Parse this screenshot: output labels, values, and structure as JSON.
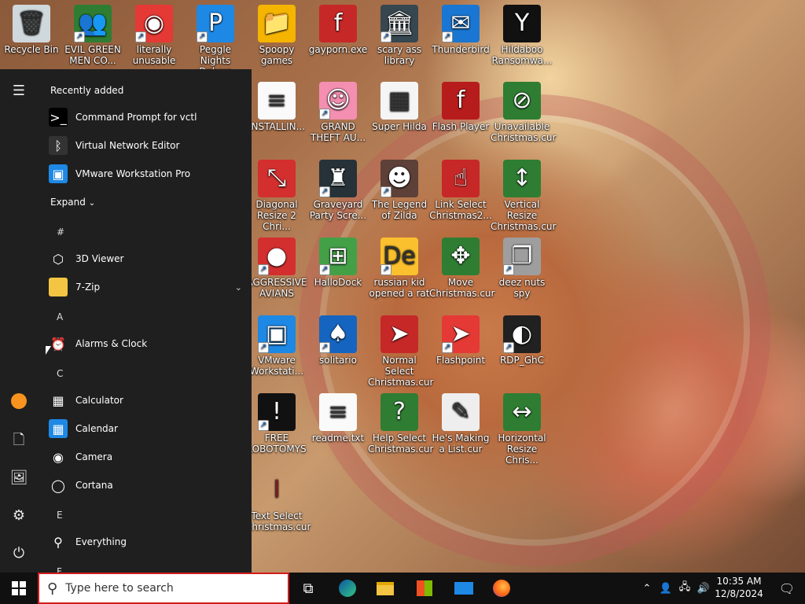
{
  "desktop": {
    "icons": [
      {
        "label": "Recycle Bin",
        "icon": "recycle-bin-icon",
        "glyph": "🗑",
        "bg": "#cfd8dc",
        "shortcut": false
      },
      {
        "label": "EVIL GREEN MEN CO...",
        "icon": "green-men-icon",
        "glyph": "👥",
        "bg": "#2e7d32",
        "shortcut": true
      },
      {
        "label": "literally unusable",
        "icon": "chrome-icon",
        "glyph": "◉",
        "bg": "#e53935",
        "shortcut": true
      },
      {
        "label": "Peggle Nights Deluxe",
        "icon": "peggle-icon",
        "glyph": "P",
        "bg": "#1e88e5",
        "shortcut": true
      },
      {
        "label": "Spoopy games",
        "icon": "folder-icon",
        "glyph": "📁",
        "bg": "#f4b400",
        "shortcut": false
      },
      {
        "label": "gayporn.exe",
        "icon": "flash-icon",
        "glyph": "f",
        "bg": "#c62828",
        "shortcut": false
      },
      {
        "label": "scary ass library",
        "icon": "library-icon",
        "glyph": "🏛",
        "bg": "#37474f",
        "shortcut": true
      },
      {
        "label": "Thunderbird",
        "icon": "thunderbird-icon",
        "glyph": "✉",
        "bg": "#1976d2",
        "shortcut": true
      },
      {
        "label": "Hildaboo Ransomwa...",
        "icon": "yashma-icon",
        "glyph": "Y",
        "bg": "#111111",
        "shortcut": false
      },
      {
        "label": "INSTALLIN...",
        "icon": "text-file-icon",
        "glyph": "≡",
        "bg": "#fafafa",
        "shortcut": false
      },
      {
        "label": "GRAND THEFT AU...",
        "icon": "anime-girl-icon",
        "glyph": "☺",
        "bg": "#f48fb1",
        "shortcut": true
      },
      {
        "label": "Super Hilda",
        "icon": "pixel-cat-icon",
        "glyph": "▦",
        "bg": "#f5f5f5",
        "shortcut": false
      },
      {
        "label": "Flash Player",
        "icon": "flash-player-icon",
        "glyph": "f",
        "bg": "#b71c1c",
        "shortcut": false
      },
      {
        "label": "Unavailable Christmas.cur",
        "icon": "unavailable-cursor-icon",
        "glyph": "⊘",
        "bg": "#2e7d32",
        "shortcut": false
      },
      {
        "label": "Diagonal Resize 2 Chri...",
        "icon": "diagonal-resize-icon",
        "glyph": "⤡",
        "bg": "#d32f2f",
        "shortcut": false
      },
      {
        "label": "Graveyard Party Scre...",
        "icon": "graveyard-icon",
        "glyph": "♜",
        "bg": "#263238",
        "shortcut": true
      },
      {
        "label": "The Legend of Zilda",
        "icon": "zilda-icon",
        "glyph": "☻",
        "bg": "#5d4037",
        "shortcut": true
      },
      {
        "label": "Link Select Christmas2...",
        "icon": "link-select-icon",
        "glyph": "☝",
        "bg": "#c62828",
        "shortcut": false
      },
      {
        "label": "Vertical Resize Christmas.cur",
        "icon": "vertical-resize-icon",
        "glyph": "↕",
        "bg": "#2e7d32",
        "shortcut": false
      },
      {
        "label": "AGGRESSIVE AVIANS",
        "icon": "angry-bird-icon",
        "glyph": "●",
        "bg": "#d32f2f",
        "shortcut": true
      },
      {
        "label": "HalloDock",
        "icon": "windows-flag-icon",
        "glyph": "⊞",
        "bg": "#43a047",
        "shortcut": true
      },
      {
        "label": "russian kid opened a rat",
        "icon": "de-icon",
        "glyph": "De",
        "bg": "#fbc02d",
        "shortcut": true
      },
      {
        "label": "Move Christmas.cur",
        "icon": "move-cursor-icon",
        "glyph": "✥",
        "bg": "#2e7d32",
        "shortcut": false
      },
      {
        "label": "deez nuts spy",
        "icon": "windows-stack-icon",
        "glyph": "❐",
        "bg": "#9e9e9e",
        "shortcut": true
      },
      {
        "label": "VMware Workstati...",
        "icon": "vmware-icon",
        "glyph": "▣",
        "bg": "#1e88e5",
        "shortcut": true
      },
      {
        "label": "solitario",
        "icon": "solitaire-icon",
        "glyph": "♠",
        "bg": "#1565c0",
        "shortcut": true
      },
      {
        "label": "Normal Select Christmas.cur",
        "icon": "normal-select-icon",
        "glyph": "➤",
        "bg": "#c62828",
        "shortcut": false
      },
      {
        "label": "Flashpoint",
        "icon": "flashpoint-icon",
        "glyph": "➤",
        "bg": "#e53935",
        "shortcut": true
      },
      {
        "label": "RDP_GhC",
        "icon": "rdp-icon",
        "glyph": "◐",
        "bg": "#212121",
        "shortcut": true
      },
      {
        "label": "FREE LOBOTOMYS",
        "icon": "lobotomy-icon",
        "glyph": "!",
        "bg": "#111111",
        "shortcut": true
      },
      {
        "label": "readme.txt",
        "icon": "text-file-icon",
        "glyph": "≡",
        "bg": "#fafafa",
        "shortcut": false
      },
      {
        "label": "Help Select Christmas.cur",
        "icon": "help-select-icon",
        "glyph": "?",
        "bg": "#2e7d32",
        "shortcut": false
      },
      {
        "label": "He's Making a List.cur",
        "icon": "scroll-list-icon",
        "glyph": "✎",
        "bg": "#eeeeee",
        "shortcut": false
      },
      {
        "label": "Horizontal Resize Chris...",
        "icon": "horizontal-resize-icon",
        "glyph": "↔",
        "bg": "#2e7d32",
        "shortcut": false
      },
      {
        "label": "Text Select Christmas.cur",
        "icon": "text-select-icon",
        "glyph": "I",
        "bg": "transparent",
        "shortcut": false
      }
    ]
  },
  "start_menu": {
    "recently_added": "Recently added",
    "expand": "Expand",
    "recent": [
      {
        "label": "Command Prompt for vctl",
        "icon": "command-prompt-icon",
        "glyph": ">_",
        "bg": "#000000"
      },
      {
        "label": "Virtual Network Editor",
        "icon": "network-editor-icon",
        "glyph": "ᛒ",
        "bg": "#333333"
      },
      {
        "label": "VMware Workstation Pro",
        "icon": "vmware-icon",
        "glyph": "▣",
        "bg": "#1e88e5"
      }
    ],
    "letters": [
      "#",
      "A",
      "C",
      "E",
      "F"
    ],
    "apps_hash": [
      {
        "label": "3D Viewer",
        "icon": "cube-icon",
        "glyph": "⬡",
        "bg": "transparent"
      },
      {
        "label": "7-Zip",
        "icon": "folder-icon",
        "glyph": "",
        "bg": "#f4c542"
      }
    ],
    "apps_a": [
      {
        "label": "Alarms & Clock",
        "icon": "alarm-clock-icon",
        "glyph": "⏰",
        "bg": "transparent"
      }
    ],
    "apps_c": [
      {
        "label": "Calculator",
        "icon": "calculator-icon",
        "glyph": "▦",
        "bg": "transparent"
      },
      {
        "label": "Calendar",
        "icon": "calendar-icon",
        "glyph": "▦",
        "bg": "#1e88e5"
      },
      {
        "label": "Camera",
        "icon": "camera-icon",
        "glyph": "◉",
        "bg": "transparent"
      },
      {
        "label": "Cortana",
        "icon": "cortana-icon",
        "glyph": "◯",
        "bg": "transparent"
      }
    ],
    "apps_e": [
      {
        "label": "Everything",
        "icon": "search-magnifier-icon",
        "glyph": "⚲",
        "bg": "transparent"
      }
    ]
  },
  "taskbar": {
    "search_placeholder": "Type here to search",
    "time": "10:35 AM",
    "date": "12/8/2024"
  }
}
